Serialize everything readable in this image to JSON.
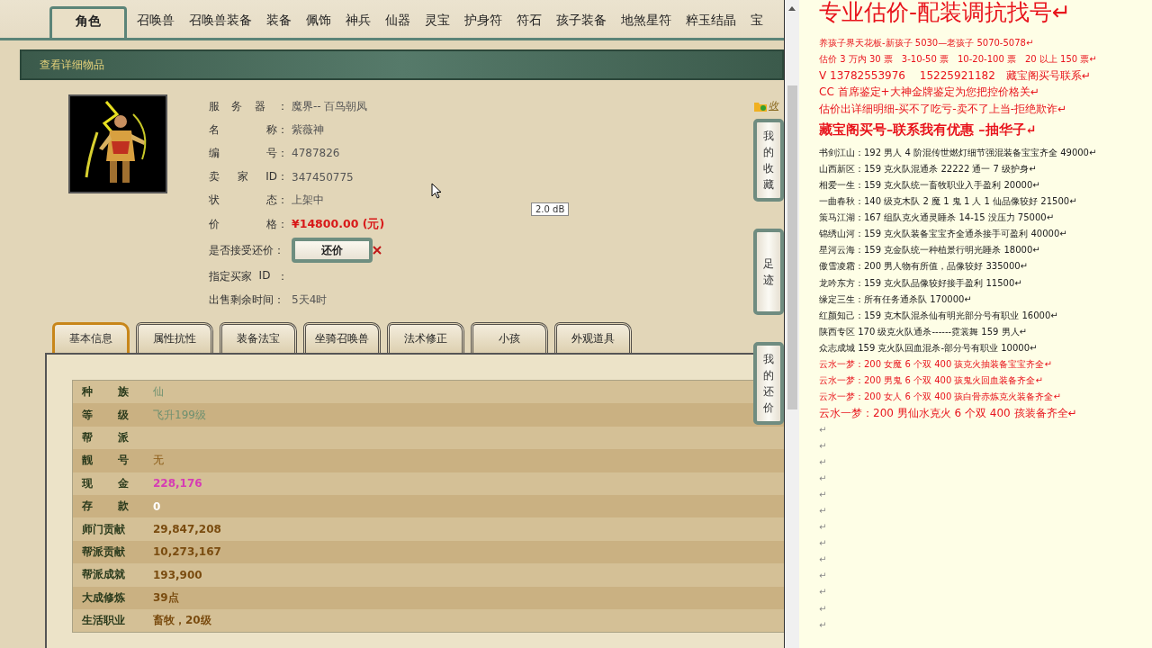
{
  "category_tabs": [
    {
      "label": "角色",
      "selected": true
    },
    {
      "label": "召唤兽",
      "selected": false
    },
    {
      "label": "召唤兽装备",
      "selected": false
    },
    {
      "label": "装备",
      "selected": false
    },
    {
      "label": "佩饰",
      "selected": false
    },
    {
      "label": "神兵",
      "selected": false
    },
    {
      "label": "仙器",
      "selected": false
    },
    {
      "label": "灵宝",
      "selected": false
    },
    {
      "label": "护身符",
      "selected": false
    },
    {
      "label": "符石",
      "selected": false
    },
    {
      "label": "孩子装备",
      "selected": false
    },
    {
      "label": "地煞星符",
      "selected": false
    },
    {
      "label": "粹玉结晶",
      "selected": false
    },
    {
      "label": "宝",
      "selected": false
    }
  ],
  "panel_title": "查看详细物品",
  "favorite_link": "收",
  "item_fields": [
    {
      "kind": "text",
      "label": "服 务 器 ：",
      "value": "魔界-- 百鸟朝凤"
    },
    {
      "kind": "text",
      "label": "名 称：",
      "value": "紫薇神"
    },
    {
      "kind": "text",
      "label": "编 号：",
      "value": "4787826"
    },
    {
      "kind": "text",
      "label": "卖 家 ID：",
      "value": "347450775"
    },
    {
      "kind": "text",
      "label": "状 态：",
      "value": "上架中"
    },
    {
      "kind": "price",
      "label": "价 格：",
      "value": "¥14800.00 (元)"
    },
    {
      "kind": "button",
      "label": "是否接受还价：",
      "value": "还价"
    },
    {
      "kind": "text",
      "label": "指定买家 ID ："
    },
    {
      "kind": "text",
      "label": "出售剩余时间：",
      "value": "5天4时"
    }
  ],
  "tooltip": "2.0 dB",
  "detail_tabs": [
    {
      "label": "基本信息",
      "selected": true
    },
    {
      "label": "属性抗性",
      "selected": false
    },
    {
      "label": "装备法宝",
      "selected": false
    },
    {
      "label": "坐骑召唤兽",
      "selected": false
    },
    {
      "label": "法术修正",
      "selected": false
    },
    {
      "label": "小孩",
      "selected": false
    },
    {
      "label": "外观道具",
      "selected": false
    }
  ],
  "basic_info": [
    {
      "label": "种 族",
      "value": "仙",
      "color": "#6e9070",
      "emphasized": false
    },
    {
      "label": "等 级",
      "value": "飞升199级",
      "color": "#6e9070",
      "emphasized": false
    },
    {
      "label": "帮 派"
    },
    {
      "label": "靓 号",
      "value": "无",
      "color": "#8a5a14",
      "emphasized": false
    },
    {
      "label": "现 金",
      "value": "228,176",
      "color": "#d63cb4",
      "emphasized": true
    },
    {
      "label": "存 款",
      "value": "0",
      "color": "#ffffff",
      "emphasized": true
    },
    {
      "label": "师门贡献",
      "value": "29,847,208",
      "color": "#7a4c10",
      "emphasized": true
    },
    {
      "label": "帮派贡献",
      "value": "10,273,167",
      "color": "#7a4c10",
      "emphasized": true
    },
    {
      "label": "帮派成就",
      "value": "193,900",
      "color": "#7a4c10",
      "emphasized": true
    },
    {
      "label": "大成修炼",
      "value": "39点",
      "color": "#7a4c10",
      "emphasized": true
    },
    {
      "label": "生活职业",
      "value": "畜牧，20级",
      "color": "#7a4c10",
      "emphasized": true
    }
  ],
  "side_buttons": [
    "我的收藏",
    "足迹",
    "我的还价"
  ],
  "document_lines": [
    {
      "kind": "title",
      "color": "#e8141c",
      "text": "专业估价-配装调抗找号↵"
    },
    {
      "kind": "note",
      "color": "#e8141c",
      "text": "养孩子界天花板-新孩子 5030—老孩子 5070-5078↵"
    },
    {
      "kind": "note",
      "color": "#e8141c",
      "text": "估价 3 万内 30 票　3-10-50 票　10-20-100 票　20 以上 150 票↵"
    },
    {
      "kind": "contact",
      "color": "#e8141c",
      "text": "V 13782553976　 15225921182　藏宝阁买号联系↵"
    },
    {
      "kind": "contact",
      "color": "#e8141c",
      "text": "CC 首席鉴定+大神金牌鉴定为您把控价格关↵"
    },
    {
      "kind": "contact",
      "color": "#e8141c",
      "text": "估价出详细明细-买不了吃亏-卖不了上当-拒绝欺诈↵"
    },
    {
      "kind": "banner",
      "color": "#e8141c",
      "text": "藏宝阁买号–联系我有优惠 –抽华子↵"
    },
    {
      "kind": "note",
      "color": "#202020",
      "text": "书剑江山：192 男人 4 阶混传世燃灯细节强混装备宝宝齐全 49000↵"
    },
    {
      "kind": "note",
      "color": "#202020",
      "text": "山西新区：159 克火队混通杀 22222 通一 7 级护身↵"
    },
    {
      "kind": "note",
      "color": "#202020",
      "text": "相爱一生：159 克火队统一畜牧职业入手盈利 20000↵"
    },
    {
      "kind": "note",
      "color": "#202020",
      "text": "一曲春秋：140 级克木队 2 魔 1 鬼 1 人 1 仙品像较好 21500↵"
    },
    {
      "kind": "note",
      "color": "#202020",
      "text": "策马江湖：167 组队克火通灵睡杀 14-15 没压力 75000↵"
    },
    {
      "kind": "note",
      "color": "#202020",
      "text": "锦绣山河：159 克火队装备宝宝齐全通杀接手可盈利 40000↵"
    },
    {
      "kind": "note",
      "color": "#202020",
      "text": "星河云海：159 克金队统一种植景行明光睡杀 18000↵"
    },
    {
      "kind": "note",
      "color": "#202020",
      "text": "傲雪凌霜：200 男人物有所值，品像较好 335000↵"
    },
    {
      "kind": "note",
      "color": "#202020",
      "text": "龙吟东方：159 克火队品像较好接手盈利 11500↵"
    },
    {
      "kind": "note",
      "color": "#202020",
      "text": "缘定三生：所有任务通杀队 170000↵"
    },
    {
      "kind": "note",
      "color": "#202020",
      "text": "红颜知己：159 克木队混杀仙有明光部分号有职业 16000↵"
    },
    {
      "kind": "note",
      "color": "#202020",
      "text": "陕西专区 170 级克火队通杀------霓裳舞 159 男人↵"
    },
    {
      "kind": "note",
      "color": "#202020",
      "text": "众志成城 159 克火队回血混杀-部分号有职业 10000↵"
    },
    {
      "kind": "note",
      "color": "#e8141c",
      "text": "云水一梦：200 女魔 6 个双 400 孩克火抽装备宝宝齐全↵"
    },
    {
      "kind": "note",
      "color": "#e8141c",
      "text": "云水一梦：200 男鬼 6 个双 400 孩鬼火回血装备齐全↵"
    },
    {
      "kind": "note",
      "color": "#e8141c",
      "text": "云水一梦：200 女人 6 个双 400 孩白骨赤炼克火装备齐全↵"
    },
    {
      "kind": "contact",
      "color": "#e8141c",
      "text": "云水一梦：200 男仙水克火 6 个双 400 孩装备齐全↵"
    },
    {
      "kind": "empty",
      "text": "↵"
    },
    {
      "kind": "empty",
      "text": "↵"
    },
    {
      "kind": "empty",
      "text": "↵"
    },
    {
      "kind": "empty",
      "text": "↵"
    },
    {
      "kind": "empty",
      "text": "↵"
    },
    {
      "kind": "empty",
      "text": "↵"
    },
    {
      "kind": "empty",
      "text": "↵"
    },
    {
      "kind": "empty",
      "text": "↵"
    },
    {
      "kind": "empty",
      "text": "↵"
    },
    {
      "kind": "empty",
      "text": "↵"
    },
    {
      "kind": "empty",
      "text": "↵"
    },
    {
      "kind": "empty",
      "text": "↵"
    },
    {
      "kind": "empty",
      "text": "↵"
    }
  ]
}
